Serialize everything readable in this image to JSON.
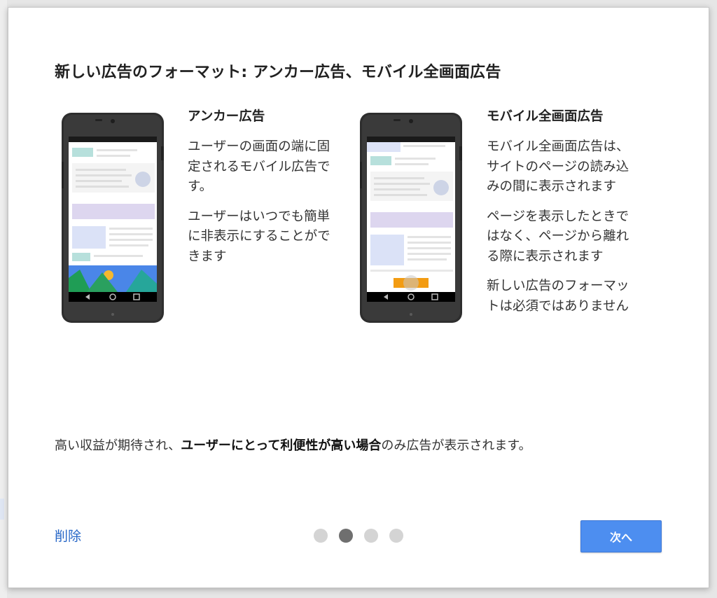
{
  "dialog": {
    "title": "新しい広告のフォーマット: アンカー広告、モバイル全画面広告",
    "columns": [
      {
        "heading": "アンカー広告",
        "paragraphs": [
          "ユーザーの画面の端に固定されるモバイル広告です。",
          "ユーザーはいつでも簡単に非表示にすることができます"
        ]
      },
      {
        "heading": "モバイル全画面広告",
        "paragraphs": [
          "モバイル全画面広告は、サイトのページの読み込みの間に表示されます",
          "ページを表示したときではなく、ページから離れる際に表示されます",
          "新しい広告のフォーマットは必須ではありません"
        ]
      }
    ],
    "summary": {
      "prefix": "高い収益が期待され、",
      "bold": "ユーザーにとって利便性が高い場合",
      "suffix": "のみ広告が表示されます。"
    },
    "delete_label": "削除",
    "next_label": "次へ",
    "pager": {
      "total": 4,
      "current": 2
    }
  },
  "colors": {
    "link": "#2767c7",
    "primary_button": "#4d8ef0",
    "dot_active": "#6f6f6f",
    "dot_inactive": "#d4d4d4"
  }
}
